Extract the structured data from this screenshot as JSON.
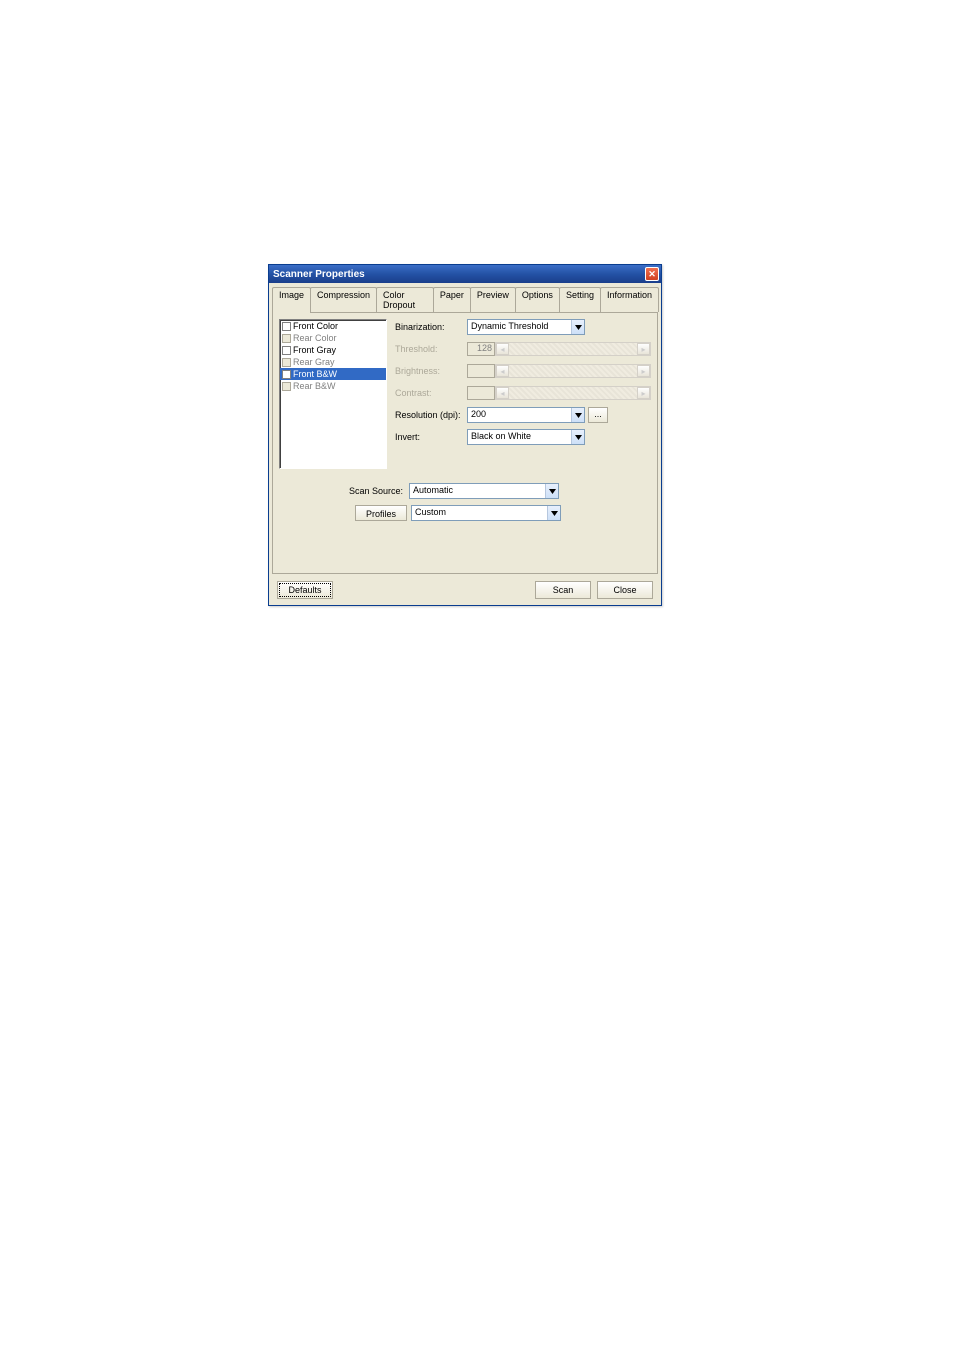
{
  "window": {
    "title": "Scanner Properties"
  },
  "tabs": {
    "image": "Image",
    "compression": "Compression",
    "color_dropout": "Color Dropout",
    "paper": "Paper",
    "preview": "Preview",
    "options": "Options",
    "setting": "Setting",
    "information": "Information"
  },
  "sidelist": {
    "front_color": "Front Color",
    "rear_color": "Rear Color",
    "front_gray": "Front Gray",
    "rear_gray": "Rear Gray",
    "front_bw": "Front B&W",
    "rear_bw": "Rear B&W"
  },
  "settings": {
    "binarization_label": "Binarization:",
    "binarization_value": "Dynamic Threshold",
    "threshold_label": "Threshold:",
    "threshold_value": "128",
    "brightness_label": "Brightness:",
    "brightness_value": "",
    "contrast_label": "Contrast:",
    "contrast_value": "",
    "resolution_label": "Resolution (dpi):",
    "resolution_value": "200",
    "more_label": "...",
    "invert_label": "Invert:",
    "invert_value": "Black on White"
  },
  "lower": {
    "scan_source_label": "Scan Source:",
    "scan_source_value": "Automatic",
    "profiles_btn": "Profiles",
    "profiles_value": "Custom"
  },
  "buttons": {
    "defaults": "Defaults",
    "scan": "Scan",
    "close": "Close"
  }
}
